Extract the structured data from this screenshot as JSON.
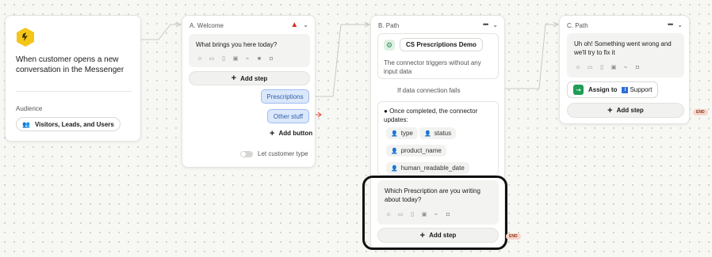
{
  "trigger": {
    "title": "When customer opens a new conversation in the Messenger",
    "audience_label": "Audience",
    "audience_value": "Visitors, Leads, and Users"
  },
  "welcome": {
    "header": "A. Welcome",
    "message": "What brings you here today?",
    "add_step": "Add step",
    "buttons": [
      "Prescriptions",
      "Other stuff"
    ],
    "add_button": "Add button",
    "toggle_label": "Let customer type"
  },
  "path_b": {
    "header": "B. Path",
    "connector_name": "CS Prescriptions Demo",
    "connector_desc": "The connector triggers without any input data",
    "fail_label": "If data connection fails",
    "completed_text": "Once completed, the connector updates:",
    "attributes": [
      "type",
      "status",
      "product_name",
      "human_readable_date"
    ],
    "question": "Which Prescription are you writing about today?",
    "add_step": "Add step",
    "end_label": "END"
  },
  "path_c": {
    "header": "C. Path",
    "message": "Uh oh! Something went wrong and we'll try to fix it",
    "assign_label": "Assign to",
    "assign_target": "Support",
    "add_step": "Add step",
    "end_label": "END"
  },
  "icons": {
    "emoji": "emoji-icon",
    "gif": "gif-icon",
    "article": "article-icon",
    "image": "image-icon",
    "attachment": "attachment-icon",
    "video": "video-icon",
    "app": "app-icon"
  },
  "colors": {
    "trigger_badge": "#f5c518",
    "chip_blue": "#dbe8fb",
    "chip_blue_border": "#9dbcf2",
    "warning": "#d93025",
    "connector_green": "#2e8b57",
    "assign_green": "#1f9d55",
    "highlight_border": "#111111",
    "end_tag": "#f7d6cc"
  }
}
